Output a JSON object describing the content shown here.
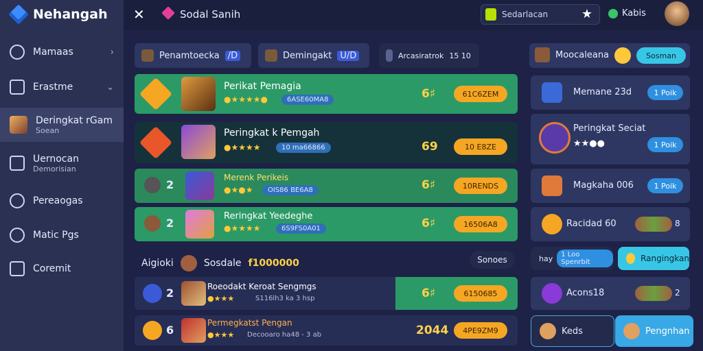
{
  "app": {
    "name": "Nehangah"
  },
  "sidebar": {
    "items": [
      {
        "label": "Mamaas"
      },
      {
        "label": "Erastme"
      },
      {
        "label": "Deringkat rGam",
        "sub": "Soean"
      },
      {
        "label": "Uernocan",
        "sub": "Demorisian"
      },
      {
        "label": "Pereaogas"
      },
      {
        "label": "Matic Pgs"
      },
      {
        "label": "Coremit"
      }
    ]
  },
  "topbar": {
    "title": "Sodal Sanih",
    "search_text": "Sedarlacan",
    "kaibs": "Kabis"
  },
  "filters": [
    {
      "label": "Penamtoecka",
      "extra": "/D"
    },
    {
      "label": "Demingakt",
      "extra": "U/D"
    },
    {
      "label": "Arcasiratrok",
      "nums": "15  10"
    }
  ],
  "rows": [
    {
      "title": "Perikat Pemagia",
      "tag": "6ASE60MA8",
      "score": "6♯",
      "btn": "61C6ZEM"
    },
    {
      "title": "Peringkat k Pemgah",
      "tag": "10 ma66866",
      "score": "69",
      "btn": "10 E8ZE"
    },
    {
      "rank": "2",
      "title": "Merenk Perikeis",
      "tag": "OIS86 BE6A8",
      "score": "6♯",
      "btn": "10RENDS"
    },
    {
      "rank": "2",
      "title": "Reringkat Yeedeghe",
      "tag": "6S9FS0A01",
      "score": "6♯",
      "btn": "16506A8"
    }
  ],
  "mid": {
    "label": "Aigioki",
    "name": "Sosdale",
    "value": "f1000000",
    "btn": "Sonoes"
  },
  "lower_rows": [
    {
      "rank": "2",
      "title": "Roeodakt Keroat Sengmgs",
      "sub": "S116lh3 ka  3 hsp",
      "score": "6♯",
      "btn": "6150685"
    },
    {
      "rank": "6",
      "title": "Permegkatst Pengan",
      "sub": "Decooaro ha48 - 3 ab",
      "score": "2044",
      "btn": "4PE9ZM9"
    }
  ],
  "right": {
    "header": "Moocaleana",
    "header_btn": "Sosman",
    "cards": [
      {
        "title": "Memane 23d",
        "pill": "1 Poik"
      },
      {
        "title": "Peringkat Seciat",
        "pill": "1 Poik"
      },
      {
        "title": "Magkaha 006",
        "pill": "1 Poik"
      },
      {
        "title": "Racidad 60",
        "num": "8"
      },
      {
        "title": "Acons18",
        "num": "2"
      }
    ],
    "mid_left": "hay",
    "mid_tag": "1 Loo Spenrbit",
    "mid_btn": "Rangingkan",
    "bottom": [
      {
        "label": "Keds"
      },
      {
        "label": "Pengnhan"
      }
    ]
  }
}
